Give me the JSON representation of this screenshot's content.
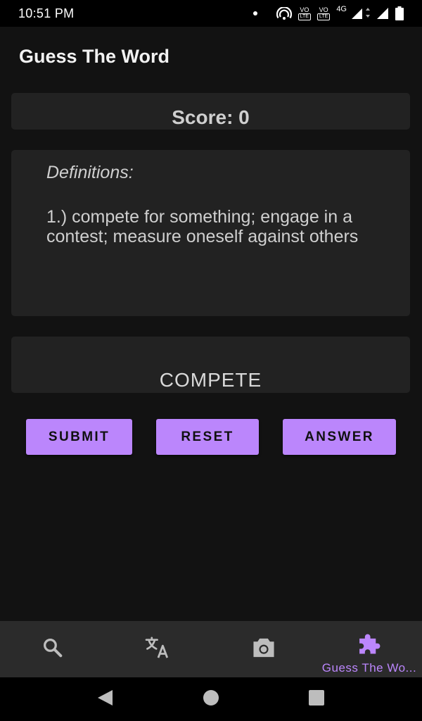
{
  "status_bar": {
    "time": "10:51 PM",
    "icons": [
      "notification-dot-icon",
      "hotspot-icon",
      "volte-1-icon",
      "volte-2-icon",
      "signal-4g-icon",
      "signal-icon",
      "battery-icon"
    ],
    "volte1_label": "VO",
    "volte1_sub": "LTE",
    "volte2_label": "VO",
    "volte2_sub": "LTE",
    "network_type": "4G"
  },
  "app_bar": {
    "title": "Guess The Word"
  },
  "score": {
    "text": "Score: 0"
  },
  "definitions": {
    "title": "Definitions:",
    "body": "1.) compete for something; engage in a contest; measure oneself against others"
  },
  "word": {
    "current": "COMPETE"
  },
  "buttons": {
    "submit_label": "SUBMIT",
    "reset_label": "RESET",
    "answer_label": "ANSWER"
  },
  "bottom_nav": {
    "items": [
      {
        "icon": "search-icon",
        "label": "",
        "active": false
      },
      {
        "icon": "translate-icon",
        "label": "",
        "active": false
      },
      {
        "icon": "camera-icon",
        "label": "",
        "active": false
      },
      {
        "icon": "puzzle-icon",
        "label": "Guess The Wo...",
        "active": true
      }
    ]
  },
  "colors": {
    "accent": "#bb86fc",
    "background": "#121212",
    "card": "#222222",
    "nav_background": "#2b2b2b",
    "inactive_icon": "#bdbdbd"
  },
  "system_nav": {
    "icons": [
      "back-icon",
      "home-icon",
      "recents-icon"
    ]
  }
}
